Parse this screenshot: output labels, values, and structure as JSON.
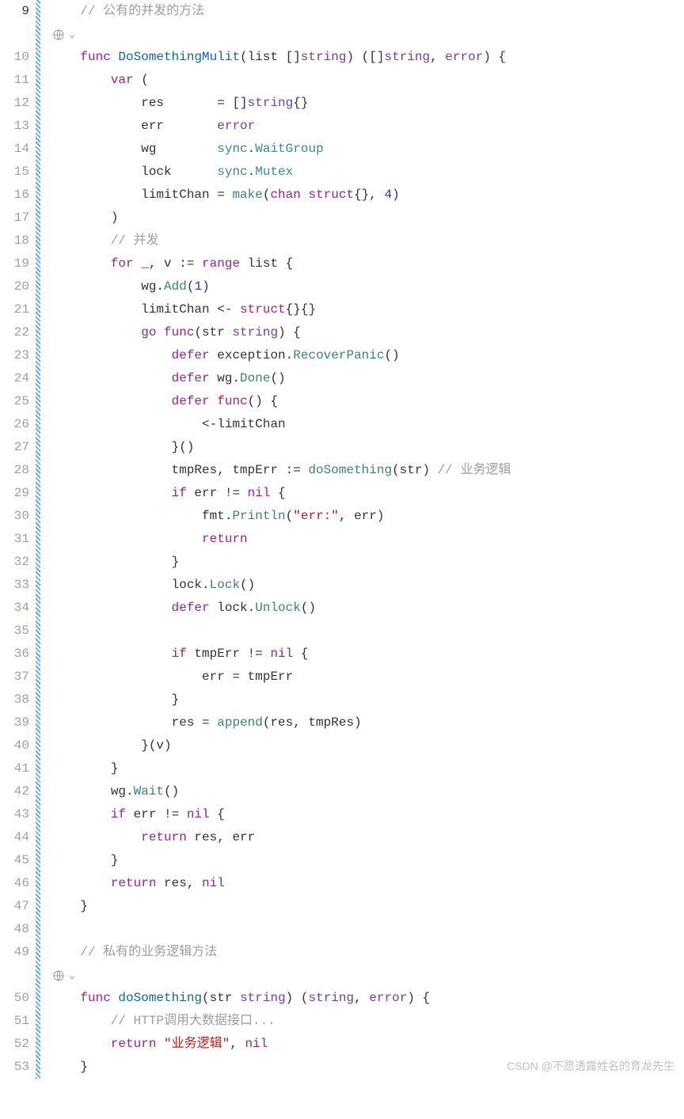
{
  "watermark": "CSDN @不愿透露姓名的育龙先生",
  "lines": [
    {
      "n": 9,
      "active": true,
      "tokens": [
        {
          "t": "    ",
          "c": ""
        },
        {
          "t": "// 公有的并发的方法",
          "c": "tk-comment"
        }
      ]
    },
    {
      "annotation": true
    },
    {
      "n": 10,
      "tokens": [
        {
          "t": "    ",
          "c": ""
        },
        {
          "t": "func",
          "c": "tk-keyword"
        },
        {
          "t": " ",
          "c": ""
        },
        {
          "t": "DoSomethingMulit",
          "c": "tk-func-name"
        },
        {
          "t": "(list []",
          "c": "tk-punct"
        },
        {
          "t": "string",
          "c": "tk-builtin"
        },
        {
          "t": ") ([]",
          "c": "tk-punct"
        },
        {
          "t": "string",
          "c": "tk-builtin"
        },
        {
          "t": ", ",
          "c": "tk-punct"
        },
        {
          "t": "error",
          "c": "tk-builtin"
        },
        {
          "t": ") {",
          "c": "tk-punct"
        }
      ]
    },
    {
      "n": 11,
      "tokens": [
        {
          "t": "        ",
          "c": ""
        },
        {
          "t": "var",
          "c": "tk-keyword"
        },
        {
          "t": " (",
          "c": "tk-punct"
        }
      ]
    },
    {
      "n": 12,
      "tokens": [
        {
          "t": "            res       = []",
          "c": "tk-ident"
        },
        {
          "t": "string",
          "c": "tk-builtin"
        },
        {
          "t": "{}",
          "c": "tk-punct"
        }
      ]
    },
    {
      "n": 13,
      "tokens": [
        {
          "t": "            err       ",
          "c": "tk-ident"
        },
        {
          "t": "error",
          "c": "tk-builtin"
        }
      ]
    },
    {
      "n": 14,
      "tokens": [
        {
          "t": "            wg        ",
          "c": "tk-ident"
        },
        {
          "t": "sync",
          "c": "tk-pkg"
        },
        {
          "t": ".",
          "c": "tk-punct"
        },
        {
          "t": "WaitGroup",
          "c": "tk-type"
        }
      ]
    },
    {
      "n": 15,
      "tokens": [
        {
          "t": "            lock      ",
          "c": "tk-ident"
        },
        {
          "t": "sync",
          "c": "tk-pkg"
        },
        {
          "t": ".",
          "c": "tk-punct"
        },
        {
          "t": "Mutex",
          "c": "tk-type"
        }
      ]
    },
    {
      "n": 16,
      "tokens": [
        {
          "t": "            limitChan = ",
          "c": "tk-ident"
        },
        {
          "t": "make",
          "c": "tk-call"
        },
        {
          "t": "(",
          "c": "tk-punct"
        },
        {
          "t": "chan",
          "c": "tk-keyword"
        },
        {
          "t": " ",
          "c": ""
        },
        {
          "t": "struct",
          "c": "tk-keyword"
        },
        {
          "t": "{}, ",
          "c": "tk-punct"
        },
        {
          "t": "4",
          "c": "tk-num"
        },
        {
          "t": ")",
          "c": "tk-punct"
        }
      ]
    },
    {
      "n": 17,
      "tokens": [
        {
          "t": "        )",
          "c": "tk-punct"
        }
      ]
    },
    {
      "n": 18,
      "tokens": [
        {
          "t": "        ",
          "c": ""
        },
        {
          "t": "// 并发",
          "c": "tk-comment"
        }
      ]
    },
    {
      "n": 19,
      "tokens": [
        {
          "t": "        ",
          "c": ""
        },
        {
          "t": "for",
          "c": "tk-keyword"
        },
        {
          "t": " _, v := ",
          "c": "tk-ident"
        },
        {
          "t": "range",
          "c": "tk-keyword"
        },
        {
          "t": " list {",
          "c": "tk-ident"
        }
      ]
    },
    {
      "n": 20,
      "tokens": [
        {
          "t": "            wg.",
          "c": "tk-ident"
        },
        {
          "t": "Add",
          "c": "tk-call"
        },
        {
          "t": "(",
          "c": "tk-punct"
        },
        {
          "t": "1",
          "c": "tk-num"
        },
        {
          "t": ")",
          "c": "tk-punct"
        }
      ]
    },
    {
      "n": 21,
      "tokens": [
        {
          "t": "            limitChan <- ",
          "c": "tk-ident"
        },
        {
          "t": "struct",
          "c": "tk-keyword"
        },
        {
          "t": "{}{}",
          "c": "tk-punct"
        }
      ]
    },
    {
      "n": 22,
      "tokens": [
        {
          "t": "            ",
          "c": ""
        },
        {
          "t": "go",
          "c": "tk-keyword"
        },
        {
          "t": " ",
          "c": ""
        },
        {
          "t": "func",
          "c": "tk-keyword"
        },
        {
          "t": "(str ",
          "c": "tk-ident"
        },
        {
          "t": "string",
          "c": "tk-builtin"
        },
        {
          "t": ") {",
          "c": "tk-punct"
        }
      ]
    },
    {
      "n": 23,
      "tokens": [
        {
          "t": "                ",
          "c": ""
        },
        {
          "t": "defer",
          "c": "tk-keyword"
        },
        {
          "t": " exception.",
          "c": "tk-ident"
        },
        {
          "t": "RecoverPanic",
          "c": "tk-call"
        },
        {
          "t": "()",
          "c": "tk-punct"
        }
      ]
    },
    {
      "n": 24,
      "tokens": [
        {
          "t": "                ",
          "c": ""
        },
        {
          "t": "defer",
          "c": "tk-keyword"
        },
        {
          "t": " wg.",
          "c": "tk-ident"
        },
        {
          "t": "Done",
          "c": "tk-call"
        },
        {
          "t": "()",
          "c": "tk-punct"
        }
      ]
    },
    {
      "n": 25,
      "tokens": [
        {
          "t": "                ",
          "c": ""
        },
        {
          "t": "defer",
          "c": "tk-keyword"
        },
        {
          "t": " ",
          "c": ""
        },
        {
          "t": "func",
          "c": "tk-keyword"
        },
        {
          "t": "() {",
          "c": "tk-punct"
        }
      ]
    },
    {
      "n": 26,
      "tokens": [
        {
          "t": "                    <-limitChan",
          "c": "tk-ident"
        }
      ]
    },
    {
      "n": 27,
      "tokens": [
        {
          "t": "                }()",
          "c": "tk-punct"
        }
      ]
    },
    {
      "n": 28,
      "tokens": [
        {
          "t": "                tmpRes, tmpErr := ",
          "c": "tk-ident"
        },
        {
          "t": "doSomething",
          "c": "tk-call"
        },
        {
          "t": "(str) ",
          "c": "tk-ident"
        },
        {
          "t": "// 业务逻辑",
          "c": "tk-comment"
        }
      ]
    },
    {
      "n": 29,
      "tokens": [
        {
          "t": "                ",
          "c": ""
        },
        {
          "t": "if",
          "c": "tk-keyword"
        },
        {
          "t": " err != ",
          "c": "tk-ident"
        },
        {
          "t": "nil",
          "c": "tk-nil"
        },
        {
          "t": " {",
          "c": "tk-punct"
        }
      ]
    },
    {
      "n": 30,
      "tokens": [
        {
          "t": "                    fmt.",
          "c": "tk-ident"
        },
        {
          "t": "Println",
          "c": "tk-call"
        },
        {
          "t": "(",
          "c": "tk-punct"
        },
        {
          "t": "\"err:\"",
          "c": "tk-string"
        },
        {
          "t": ", err)",
          "c": "tk-ident"
        }
      ]
    },
    {
      "n": 31,
      "tokens": [
        {
          "t": "                    ",
          "c": ""
        },
        {
          "t": "return",
          "c": "tk-keyword"
        }
      ]
    },
    {
      "n": 32,
      "tokens": [
        {
          "t": "                }",
          "c": "tk-punct"
        }
      ]
    },
    {
      "n": 33,
      "tokens": [
        {
          "t": "                lock.",
          "c": "tk-ident"
        },
        {
          "t": "Lock",
          "c": "tk-call"
        },
        {
          "t": "()",
          "c": "tk-punct"
        }
      ]
    },
    {
      "n": 34,
      "tokens": [
        {
          "t": "                ",
          "c": ""
        },
        {
          "t": "defer",
          "c": "tk-keyword"
        },
        {
          "t": " lock.",
          "c": "tk-ident"
        },
        {
          "t": "Unlock",
          "c": "tk-call"
        },
        {
          "t": "()",
          "c": "tk-punct"
        }
      ]
    },
    {
      "n": 35,
      "tokens": [
        {
          "t": "",
          "c": ""
        }
      ]
    },
    {
      "n": 36,
      "tokens": [
        {
          "t": "                ",
          "c": ""
        },
        {
          "t": "if",
          "c": "tk-keyword"
        },
        {
          "t": " tmpErr != ",
          "c": "tk-ident"
        },
        {
          "t": "nil",
          "c": "tk-nil"
        },
        {
          "t": " {",
          "c": "tk-punct"
        }
      ]
    },
    {
      "n": 37,
      "tokens": [
        {
          "t": "                    err = tmpErr",
          "c": "tk-ident"
        }
      ]
    },
    {
      "n": 38,
      "tokens": [
        {
          "t": "                }",
          "c": "tk-punct"
        }
      ]
    },
    {
      "n": 39,
      "tokens": [
        {
          "t": "                res = ",
          "c": "tk-ident"
        },
        {
          "t": "append",
          "c": "tk-call"
        },
        {
          "t": "(res, tmpRes)",
          "c": "tk-ident"
        }
      ]
    },
    {
      "n": 40,
      "tokens": [
        {
          "t": "            }(v)",
          "c": "tk-punct"
        }
      ]
    },
    {
      "n": 41,
      "tokens": [
        {
          "t": "        }",
          "c": "tk-punct"
        }
      ]
    },
    {
      "n": 42,
      "tokens": [
        {
          "t": "        wg.",
          "c": "tk-ident"
        },
        {
          "t": "Wait",
          "c": "tk-call"
        },
        {
          "t": "()",
          "c": "tk-punct"
        }
      ]
    },
    {
      "n": 43,
      "tokens": [
        {
          "t": "        ",
          "c": ""
        },
        {
          "t": "if",
          "c": "tk-keyword"
        },
        {
          "t": " err != ",
          "c": "tk-ident"
        },
        {
          "t": "nil",
          "c": "tk-nil"
        },
        {
          "t": " {",
          "c": "tk-punct"
        }
      ]
    },
    {
      "n": 44,
      "tokens": [
        {
          "t": "            ",
          "c": ""
        },
        {
          "t": "return",
          "c": "tk-keyword"
        },
        {
          "t": " res, err",
          "c": "tk-ident"
        }
      ]
    },
    {
      "n": 45,
      "tokens": [
        {
          "t": "        }",
          "c": "tk-punct"
        }
      ]
    },
    {
      "n": 46,
      "tokens": [
        {
          "t": "        ",
          "c": ""
        },
        {
          "t": "return",
          "c": "tk-keyword"
        },
        {
          "t": " res, ",
          "c": "tk-ident"
        },
        {
          "t": "nil",
          "c": "tk-nil"
        }
      ]
    },
    {
      "n": 47,
      "tokens": [
        {
          "t": "    }",
          "c": "tk-punct"
        }
      ]
    },
    {
      "n": 48,
      "tokens": [
        {
          "t": "",
          "c": ""
        }
      ]
    },
    {
      "n": 49,
      "tokens": [
        {
          "t": "    ",
          "c": ""
        },
        {
          "t": "// 私有的业务逻辑方法",
          "c": "tk-comment"
        }
      ]
    },
    {
      "annotation": true
    },
    {
      "n": 50,
      "tokens": [
        {
          "t": "    ",
          "c": ""
        },
        {
          "t": "func",
          "c": "tk-keyword"
        },
        {
          "t": " ",
          "c": ""
        },
        {
          "t": "doSomething",
          "c": "tk-func-name"
        },
        {
          "t": "(str ",
          "c": "tk-ident"
        },
        {
          "t": "string",
          "c": "tk-builtin"
        },
        {
          "t": ") (",
          "c": "tk-punct"
        },
        {
          "t": "string",
          "c": "tk-builtin"
        },
        {
          "t": ", ",
          "c": "tk-punct"
        },
        {
          "t": "error",
          "c": "tk-builtin"
        },
        {
          "t": ") {",
          "c": "tk-punct"
        }
      ]
    },
    {
      "n": 51,
      "tokens": [
        {
          "t": "        ",
          "c": ""
        },
        {
          "t": "// HTTP调用大数据接口...",
          "c": "tk-comment"
        }
      ]
    },
    {
      "n": 52,
      "tokens": [
        {
          "t": "        ",
          "c": ""
        },
        {
          "t": "return",
          "c": "tk-keyword"
        },
        {
          "t": " ",
          "c": ""
        },
        {
          "t": "\"业务逻辑\"",
          "c": "tk-string"
        },
        {
          "t": ", ",
          "c": "tk-punct"
        },
        {
          "t": "nil",
          "c": "tk-nil"
        }
      ]
    },
    {
      "n": 53,
      "tokens": [
        {
          "t": "    }",
          "c": "tk-punct"
        }
      ]
    }
  ]
}
